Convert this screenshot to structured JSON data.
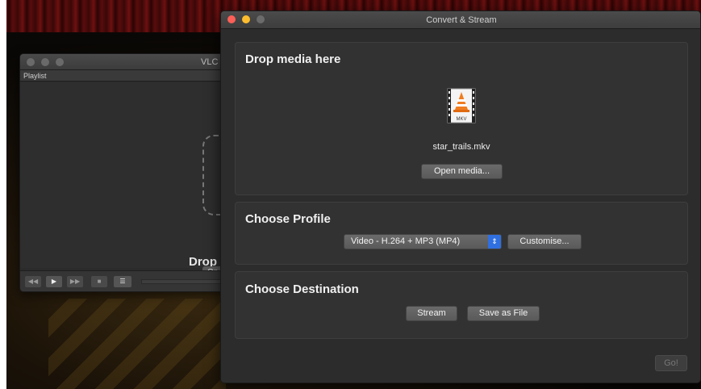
{
  "vlc_window": {
    "title": "VLC",
    "playlist_label": "Playlist",
    "drop_label": "Drop",
    "open_button_label": "Op"
  },
  "convert_window": {
    "title": "Convert & Stream",
    "drop_section": {
      "heading": "Drop media here",
      "file_name": "star_trails.mkv",
      "file_icon_badge": "MKV",
      "open_media_label": "Open media..."
    },
    "profile_section": {
      "heading": "Choose Profile",
      "selected_profile": "Video - H.264 + MP3 (MP4)",
      "customise_label": "Customise..."
    },
    "destination_section": {
      "heading": "Choose Destination",
      "stream_label": "Stream",
      "save_as_file_label": "Save as File"
    },
    "go_label": "Go!"
  },
  "colors": {
    "close": "#fc5f57",
    "minimize": "#fdbc2e",
    "select_accent": "#2f6fe0",
    "vlc_cone": "#f07c1e"
  }
}
